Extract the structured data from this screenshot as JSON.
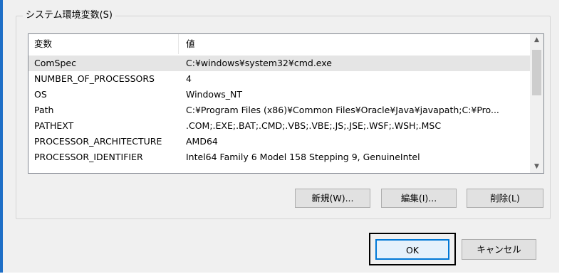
{
  "group": {
    "label": "システム環境変数(S)"
  },
  "list": {
    "columns": [
      "変数",
      "値"
    ],
    "rows": [
      {
        "name": "ComSpec",
        "value": "C:¥windows¥system32¥cmd.exe"
      },
      {
        "name": "NUMBER_OF_PROCESSORS",
        "value": "4"
      },
      {
        "name": "OS",
        "value": "Windows_NT"
      },
      {
        "name": "Path",
        "value": "C:¥Program Files (x86)¥Common Files¥Oracle¥Java¥javapath;C:¥Pro..."
      },
      {
        "name": "PATHEXT",
        "value": ".COM;.EXE;.BAT;.CMD;.VBS;.VBE;.JS;.JSE;.WSF;.WSH;.MSC"
      },
      {
        "name": "PROCESSOR_ARCHITECTURE",
        "value": "AMD64"
      },
      {
        "name": "PROCESSOR_IDENTIFIER",
        "value": "Intel64 Family 6 Model 158 Stepping 9, GenuineIntel"
      }
    ],
    "selected_index": 0,
    "scroll_up_icon": "chevron-up-icon",
    "scroll_down_icon": "chevron-down-icon"
  },
  "buttons": {
    "new": "新規(W)...",
    "edit": "編集(I)...",
    "delete": "削除(L)",
    "ok": "OK",
    "cancel": "キャンセル"
  },
  "colors": {
    "focus_border": "#0078d7",
    "selection": "#e5e5e5",
    "window_edge": "#1e6fc7"
  }
}
